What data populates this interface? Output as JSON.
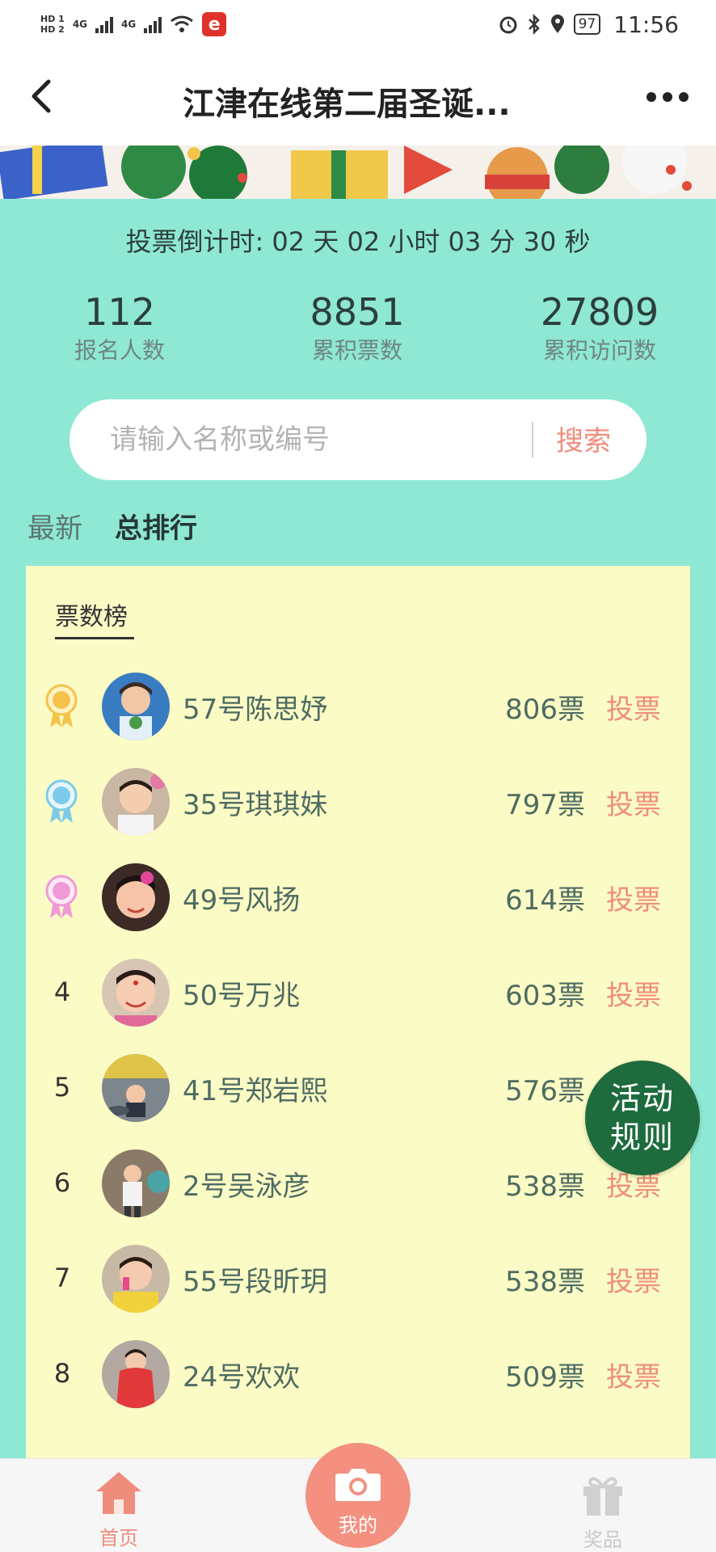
{
  "status_bar": {
    "hd1": "HD 1",
    "hd2": "HD 2",
    "net1": "4G",
    "net2": "4G",
    "app_letter": "e",
    "battery": "97",
    "time": "11:56"
  },
  "header": {
    "title": "江津在线第二届圣诞..."
  },
  "countdown": "投票倒计时: 02 天 02 小时 03 分 30 秒",
  "stats": [
    {
      "value": "112",
      "label": "报名人数"
    },
    {
      "value": "8851",
      "label": "累积票数"
    },
    {
      "value": "27809",
      "label": "累积访问数"
    }
  ],
  "search": {
    "placeholder": "请输入名称或编号",
    "button": "搜索"
  },
  "tabs": [
    {
      "label": "最新",
      "active": false
    },
    {
      "label": "总排行",
      "active": true
    }
  ],
  "leaderboard": {
    "title": "票数榜",
    "vote_label": "投票",
    "rows": [
      {
        "rank": "1",
        "medal": "gold",
        "name": "57号陈思妤",
        "votes": "806票"
      },
      {
        "rank": "2",
        "medal": "blue",
        "name": "35号琪琪妹",
        "votes": "797票"
      },
      {
        "rank": "3",
        "medal": "pink",
        "name": "49号风扬",
        "votes": "614票"
      },
      {
        "rank": "4",
        "medal": "",
        "name": "50号万兆",
        "votes": "603票"
      },
      {
        "rank": "5",
        "medal": "",
        "name": "41号郑岩熙",
        "votes": "576票"
      },
      {
        "rank": "6",
        "medal": "",
        "name": "2号吴泳彦",
        "votes": "538票"
      },
      {
        "rank": "7",
        "medal": "",
        "name": "55号段昕玥",
        "votes": "538票"
      },
      {
        "rank": "8",
        "medal": "",
        "name": "24号欢欢",
        "votes": "509票"
      }
    ]
  },
  "rules_button": {
    "line1": "活动",
    "line2": "规则"
  },
  "bottom_nav": {
    "home": "首页",
    "mine": "我的",
    "gift": "奖品"
  },
  "colors": {
    "background": "#8ee8d4",
    "panel": "#fbfbc5",
    "accent": "#ef8d7d",
    "rules": "#1e6b3e"
  }
}
